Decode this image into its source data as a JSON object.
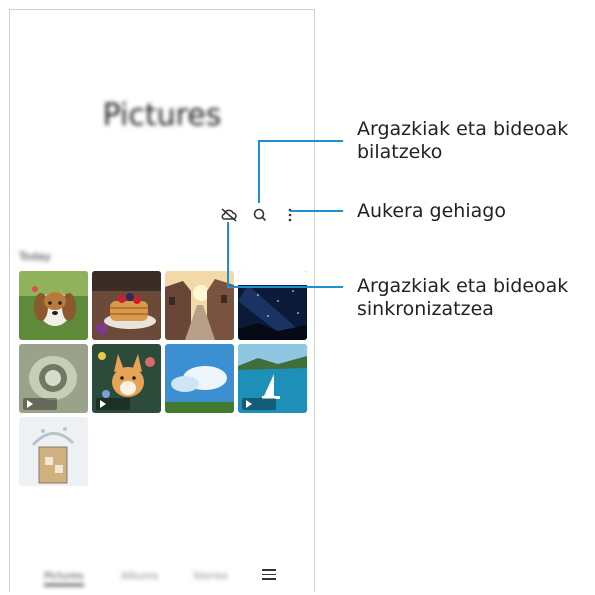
{
  "app": {
    "title": "Pictures",
    "section_label": "Today"
  },
  "toolbar": {
    "icons": [
      "cloud-sync-off-icon",
      "search-icon",
      "more-options-icon"
    ]
  },
  "thumbnails": [
    {
      "subject": "beagle",
      "video": false
    },
    {
      "subject": "pancakes",
      "video": false
    },
    {
      "subject": "street",
      "video": false
    },
    {
      "subject": "night-sky",
      "video": false
    },
    {
      "subject": "water-glass",
      "video": true
    },
    {
      "subject": "corgi",
      "video": true
    },
    {
      "subject": "sky-field",
      "video": false
    },
    {
      "subject": "sailboat",
      "video": true
    },
    {
      "subject": "splash",
      "video": false
    }
  ],
  "bottom_nav": {
    "items": [
      "Pictures",
      "Albums",
      "Stories"
    ],
    "active": 0
  },
  "callouts": {
    "search": [
      "Argazkiak eta bideoak",
      "bilatzeko"
    ],
    "more": [
      "Aukera gehiago"
    ],
    "sync": [
      "Argazkiak eta bideoak",
      "sinkronizatzea"
    ]
  },
  "colors": {
    "callout_line": "#1e8fd5"
  }
}
